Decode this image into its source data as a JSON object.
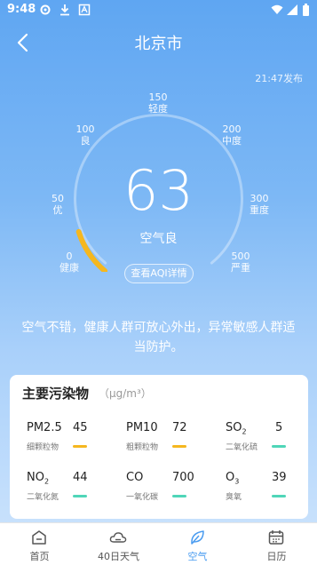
{
  "status_bar": {
    "time": "9:48"
  },
  "header": {
    "city": "北京市",
    "publish_time": "21:47发布"
  },
  "gauge": {
    "value": "63",
    "level": "空气良",
    "detail_button": "查看AQI详情",
    "progress_fraction": 0.126,
    "accent_color": "#f5b71f",
    "scale": [
      {
        "value": "0",
        "label": "健康"
      },
      {
        "value": "50",
        "label": "优"
      },
      {
        "value": "100",
        "label": "良"
      },
      {
        "value": "150",
        "label": "轻度"
      },
      {
        "value": "200",
        "label": "中度"
      },
      {
        "value": "300",
        "label": "重度"
      },
      {
        "value": "500",
        "label": "严重"
      }
    ]
  },
  "advice": "空气不错，健康人群可放心外出，异常敏感人群适当防护。",
  "pollutants": {
    "title": "主要污染物",
    "unit": "（μg/m³）",
    "items": [
      {
        "name": "PM2.5",
        "sub": "",
        "desc": "细颗粒物",
        "value": "45",
        "color": "#f5b71f"
      },
      {
        "name": "PM10",
        "sub": "",
        "desc": "粗颗粒物",
        "value": "72",
        "color": "#f5b71f"
      },
      {
        "name": "SO",
        "sub": "2",
        "desc": "二氧化硫",
        "value": "5",
        "color": "#4fd6b8"
      },
      {
        "name": "NO",
        "sub": "2",
        "desc": "二氧化氮",
        "value": "44",
        "color": "#4fd6b8"
      },
      {
        "name": "CO",
        "sub": "",
        "desc": "一氧化碳",
        "value": "700",
        "color": "#4fd6b8"
      },
      {
        "name": "O",
        "sub": "3",
        "desc": "臭氧",
        "value": "39",
        "color": "#4fd6b8"
      }
    ]
  },
  "tabs": [
    {
      "label": "首页",
      "icon": "home-icon",
      "active": false
    },
    {
      "label": "40日天气",
      "icon": "cloud-icon",
      "active": false
    },
    {
      "label": "空气",
      "icon": "leaf-icon",
      "active": true
    },
    {
      "label": "日历",
      "icon": "calendar-icon",
      "active": false
    }
  ]
}
